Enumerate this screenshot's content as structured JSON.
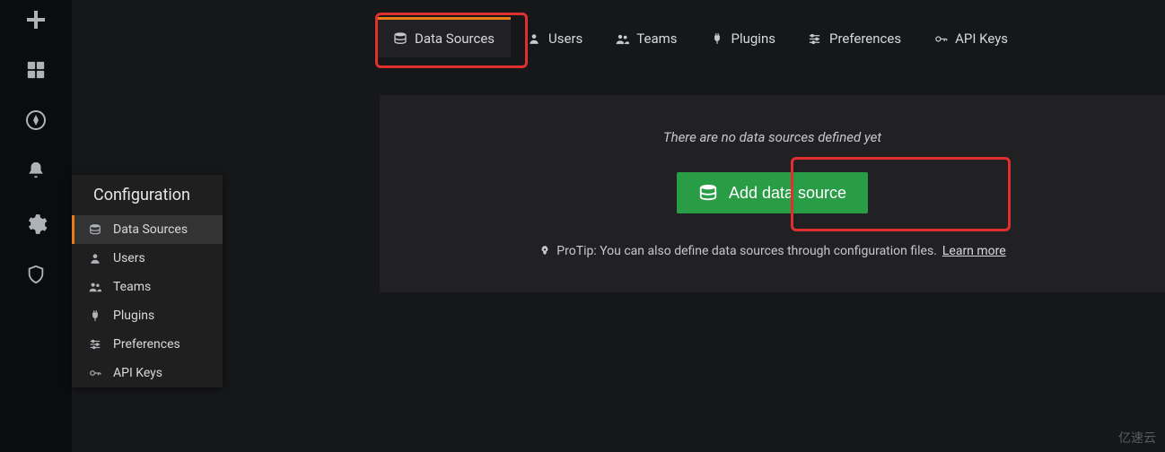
{
  "sidebar": {
    "items": [
      {
        "icon": "plus",
        "name": "create-icon"
      },
      {
        "icon": "dashboard",
        "name": "dashboard-icon"
      },
      {
        "icon": "explore",
        "name": "explore-icon"
      },
      {
        "icon": "bell",
        "name": "alerting-icon"
      },
      {
        "icon": "gear",
        "name": "configuration-icon"
      },
      {
        "icon": "shield",
        "name": "admin-icon"
      }
    ]
  },
  "flyout": {
    "title": "Configuration",
    "items": [
      {
        "label": "Data Sources",
        "icon": "database",
        "active": true
      },
      {
        "label": "Users",
        "icon": "user",
        "active": false
      },
      {
        "label": "Teams",
        "icon": "users",
        "active": false
      },
      {
        "label": "Plugins",
        "icon": "plug",
        "active": false
      },
      {
        "label": "Preferences",
        "icon": "sliders",
        "active": false
      },
      {
        "label": "API Keys",
        "icon": "key",
        "active": false
      }
    ]
  },
  "tabs": [
    {
      "label": "Data Sources",
      "icon": "database",
      "active": true
    },
    {
      "label": "Users",
      "icon": "user",
      "active": false
    },
    {
      "label": "Teams",
      "icon": "users",
      "active": false
    },
    {
      "label": "Plugins",
      "icon": "plug",
      "active": false
    },
    {
      "label": "Preferences",
      "icon": "sliders",
      "active": false
    },
    {
      "label": "API Keys",
      "icon": "key",
      "active": false
    }
  ],
  "main": {
    "empty_message": "There are no data sources defined yet",
    "add_button_label": "Add data source",
    "protip_prefix": "ProTip: You can also define data sources through configuration files. ",
    "protip_link": "Learn more"
  },
  "watermark": "亿速云"
}
